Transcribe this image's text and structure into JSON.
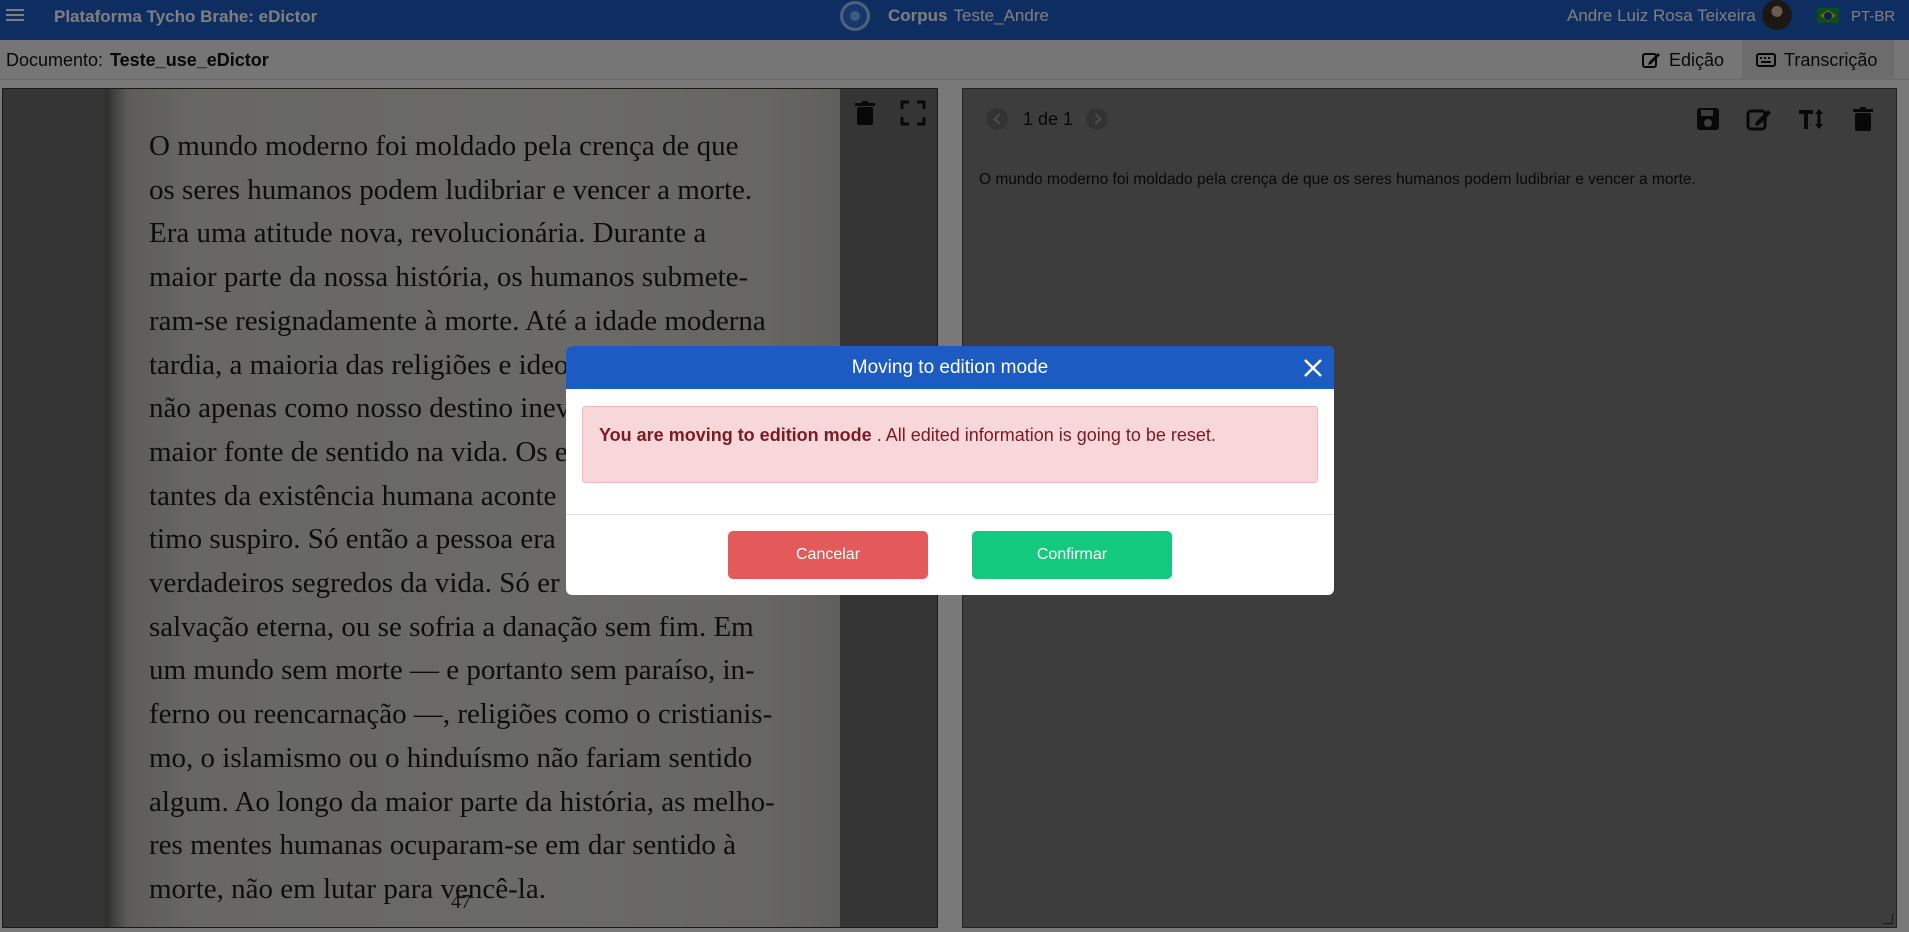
{
  "topbar": {
    "app_title": "Plataforma Tycho Brahe: eDictor",
    "corpus_label": "Corpus",
    "corpus_name": "Teste_Andre",
    "user_name": "Andre Luiz Rosa Teixeira",
    "language": "PT-BR",
    "icons": [
      "menu-icon",
      "corpus-logo",
      "avatar",
      "brazil-flag-icon"
    ]
  },
  "docbar": {
    "document_label": "Documento:",
    "document_name": "Teste_use_eDictor",
    "modes": [
      {
        "label": "Edição",
        "icon": "edit-icon",
        "active": false
      },
      {
        "label": "Transcrição",
        "icon": "keyboard-icon",
        "active": true
      }
    ]
  },
  "image_panel": {
    "page_lines": [
      "O mundo moderno foi moldado pela crença de que",
      "os seres humanos podem ludibriar e vencer a morte.",
      "Era uma atitude nova, revolucionária. Durante a",
      "maior parte da nossa história, os humanos submete-",
      "ram-se resignadamente à morte. Até a idade moderna",
      "tardia, a maioria das religiões e ideo",
      "não apenas como nosso destino inev",
      "maior fonte de sentido na vida. Os ev",
      "tantes da existência humana aconte",
      "timo suspiro. Só então a pessoa era",
      "verdadeiros segredos da vida. Só er",
      "salvação eterna, ou se sofria a danação sem fim. Em",
      "um mundo sem morte — e portanto sem paraíso, in-",
      "ferno ou reencarnação —, religiões como o cristianis-",
      "mo, o islamismo ou o hinduísmo não fariam sentido",
      "algum. Ao longo da maior parte da história, as melho-",
      "res mentes humanas ocuparam-se em dar sentido à",
      "morte, não em lutar para vencê-la."
    ],
    "page_number": "47",
    "tools": [
      "trash-icon",
      "expand-icon"
    ]
  },
  "transcription_panel": {
    "pager": "1 de 1",
    "text": "O mundo moderno foi moldado pela crença de que os seres humanos podem ludibriar e vencer a morte.",
    "tools": [
      "save-icon",
      "edit-icon",
      "text-size-icon",
      "trash-icon"
    ]
  },
  "modal": {
    "title": "Moving to edition mode",
    "alert_strong": "You are moving to edition mode",
    "alert_rest": " . All edited information is going to be reset.",
    "cancel_label": "Cancelar",
    "confirm_label": "Confirmar",
    "colors": {
      "header": "#1c5bc2",
      "alert_bg": "#f8d7da",
      "cancel": "#e45a5a",
      "confirm": "#13c97d"
    }
  }
}
